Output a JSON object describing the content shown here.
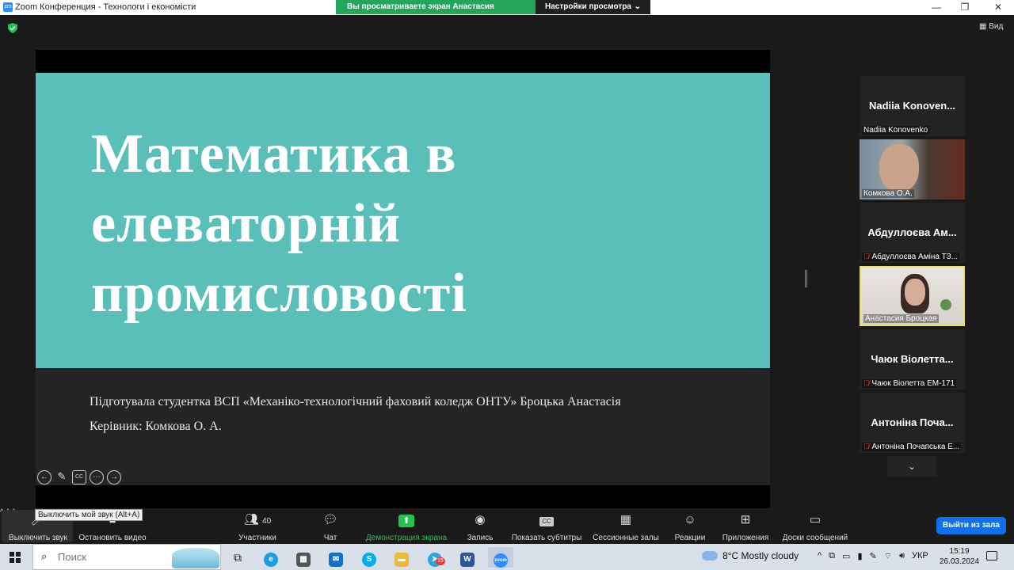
{
  "window": {
    "title": "Zoom Конференция - Технологи і економісти",
    "app_icon_text": "zm"
  },
  "share_banner": {
    "viewing_text": "Вы просматриваете экран Анастасия Броцкая",
    "view_options_label": "Настройки просмотра"
  },
  "stage": {
    "view_label": "Вид"
  },
  "slide": {
    "title_lines": [
      "Математика в",
      "елеваторній",
      "промисловості"
    ],
    "author": "Підготувала студентка ВСП «Механіко-технологічний фаховий коледж ОНТУ» Броцька Анастасія",
    "supervisor": "Керівник: Комкова О. А.",
    "colors": {
      "teal": "#5bbfb9",
      "dark": "#262324"
    }
  },
  "participants": [
    {
      "display_name": "Nadiia Konoven...",
      "label": "Nadiia Konovenko",
      "video": false,
      "muted": false
    },
    {
      "display_name": "",
      "label": "Комкова О.А.",
      "video": true,
      "muted": false
    },
    {
      "display_name": "Абдуллоєва Ам...",
      "label": "Абдуллоєва Аміна ТЗ...",
      "video": false,
      "muted": true
    },
    {
      "display_name": "",
      "label": "Анастасия Броцкая",
      "video": true,
      "muted": false,
      "active_speaker": true
    },
    {
      "display_name": "Чаюк Віолетта...",
      "label": "Чаюк Віолетта ЕМ-171",
      "video": false,
      "muted": true
    },
    {
      "display_name": "Антоніна Поча...",
      "label": "Антоніна Почапська Е...",
      "video": false,
      "muted": true
    }
  ],
  "toolbar": {
    "mute_label": "Выключить звук",
    "mute_tooltip": "Выключить мой звук (Alt+A)",
    "video_label": "Остановить видео",
    "participants_label": "Участники",
    "participants_count": "40",
    "chat_label": "Чат",
    "share_label": "Демонстрация экрана",
    "record_label": "Запись",
    "captions_label": "Показать субтитры",
    "breakout_label": "Сессионные залы",
    "reactions_label": "Реакции",
    "apps_label": "Приложения",
    "whiteboard_label": "Доски сообщений",
    "leave_label": "Выйти из зала",
    "accent_green": "#23c552",
    "accent_blue": "#0e71eb"
  },
  "taskbar": {
    "search_placeholder": "Поиск",
    "telegram_badge": "15",
    "weather": "8°C  Mostly cloudy",
    "language": "УКР",
    "time": "15:19",
    "date": "26.03.2024"
  }
}
